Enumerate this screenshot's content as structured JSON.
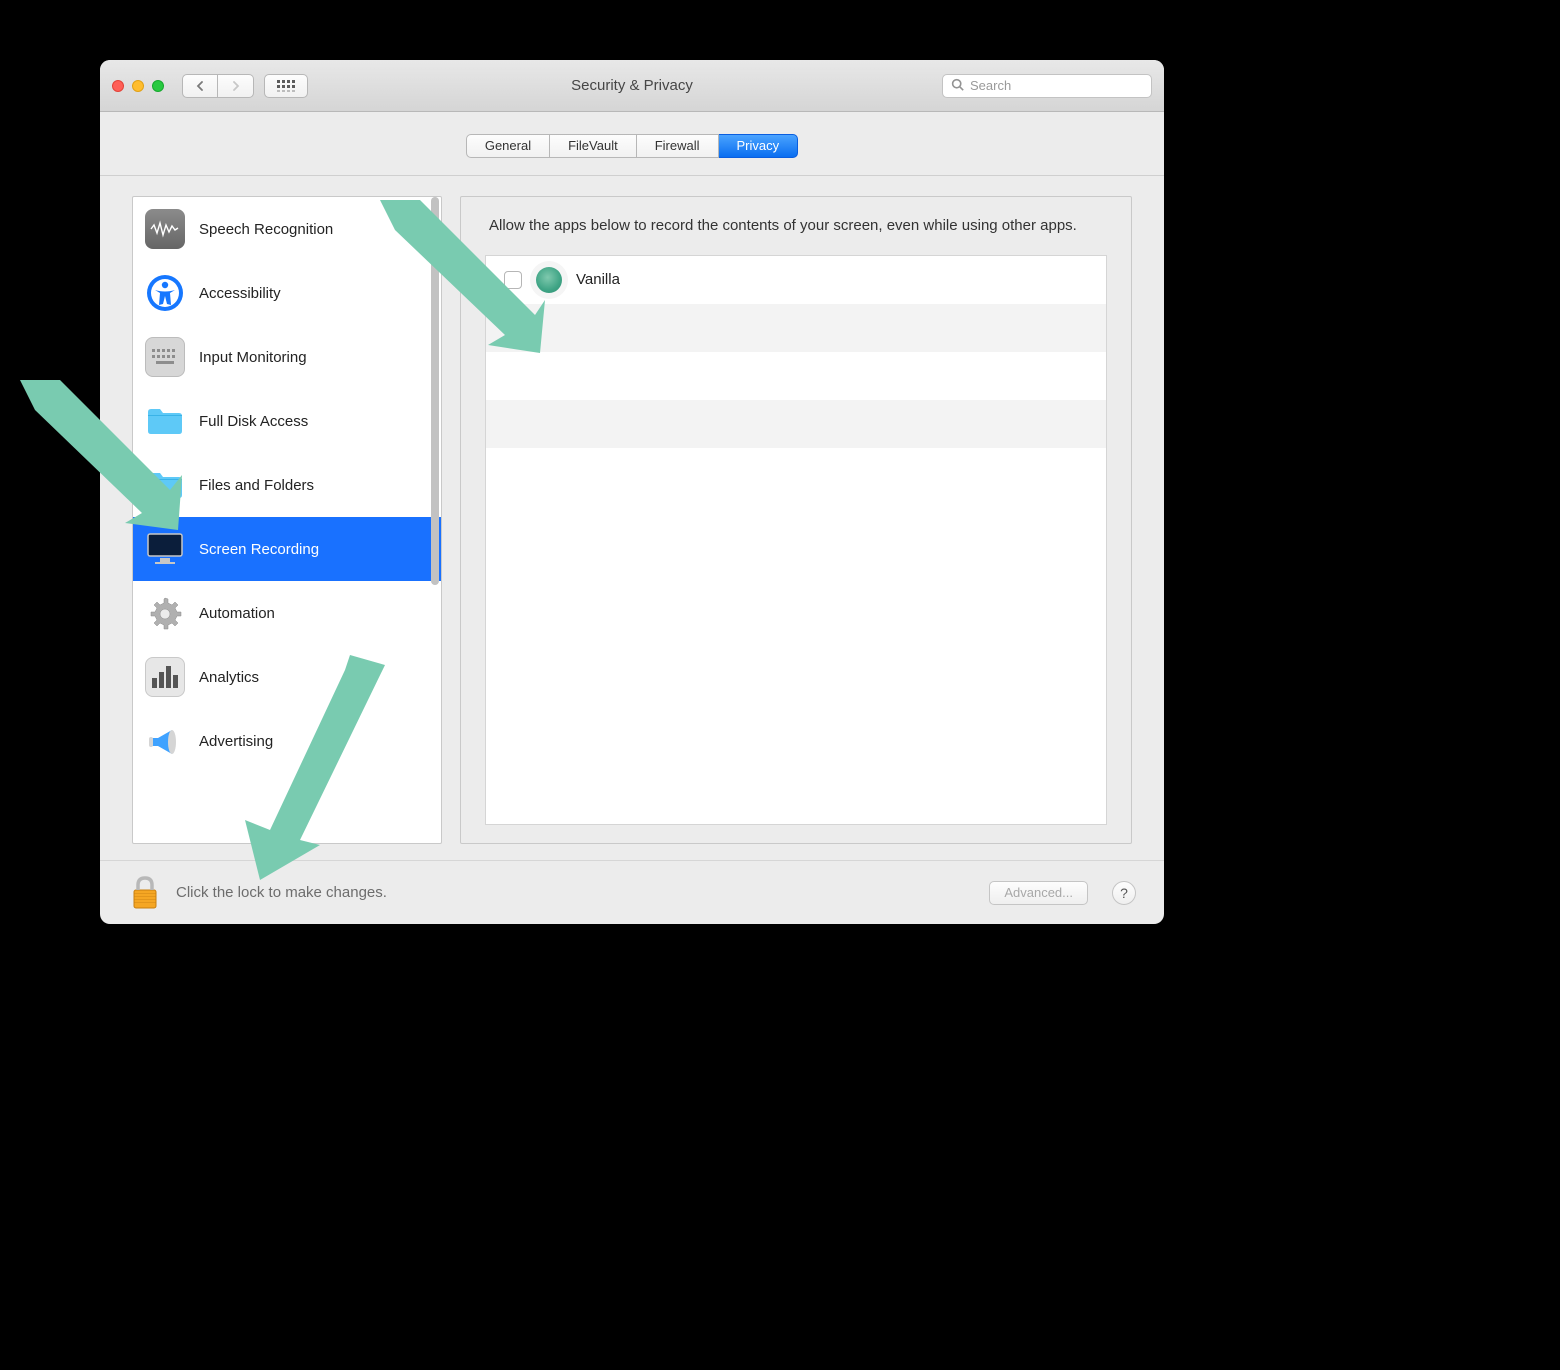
{
  "window_title": "Security & Privacy",
  "search": {
    "placeholder": "Search"
  },
  "tabs": [
    {
      "label": "General",
      "active": false
    },
    {
      "label": "FileVault",
      "active": false
    },
    {
      "label": "Firewall",
      "active": false
    },
    {
      "label": "Privacy",
      "active": true
    }
  ],
  "sidebar": {
    "items": [
      {
        "label": "Speech Recognition",
        "icon": "speech",
        "selected": false
      },
      {
        "label": "Accessibility",
        "icon": "accessibility",
        "selected": false
      },
      {
        "label": "Input Monitoring",
        "icon": "keyboard",
        "selected": false
      },
      {
        "label": "Full Disk Access",
        "icon": "folder",
        "selected": false
      },
      {
        "label": "Files and Folders",
        "icon": "folder",
        "selected": false
      },
      {
        "label": "Screen Recording",
        "icon": "display",
        "selected": true
      },
      {
        "label": "Automation",
        "icon": "gear",
        "selected": false
      },
      {
        "label": "Analytics",
        "icon": "bars",
        "selected": false
      },
      {
        "label": "Advertising",
        "icon": "megaphone",
        "selected": false
      }
    ]
  },
  "detail": {
    "description": "Allow the apps below to record the contents of your screen, even while using other apps.",
    "apps": [
      {
        "name": "Vanilla",
        "checked": false
      }
    ]
  },
  "footer": {
    "lock_text": "Click the lock to make changes.",
    "advanced_label": "Advanced...",
    "help_label": "?"
  }
}
